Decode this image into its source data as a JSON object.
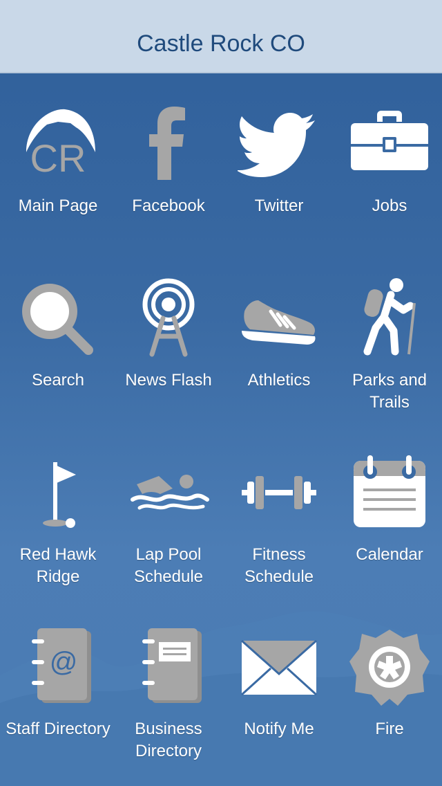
{
  "header": {
    "title": "Castle Rock CO"
  },
  "tiles": [
    {
      "label": "Main Page",
      "icon": "castle-rock-logo-icon"
    },
    {
      "label": "Facebook",
      "icon": "facebook-icon"
    },
    {
      "label": "Twitter",
      "icon": "twitter-bird-icon"
    },
    {
      "label": "Jobs",
      "icon": "briefcase-icon"
    },
    {
      "label": "Search",
      "icon": "magnifier-icon"
    },
    {
      "label": "News Flash",
      "icon": "broadcast-tower-icon"
    },
    {
      "label": "Athletics",
      "icon": "sneaker-icon"
    },
    {
      "label": "Parks and Trails",
      "icon": "hiker-icon"
    },
    {
      "label": "Red Hawk Ridge",
      "icon": "golf-flag-icon"
    },
    {
      "label": "Lap Pool Schedule",
      "icon": "swimmer-icon"
    },
    {
      "label": "Fitness Schedule",
      "icon": "dumbbell-icon"
    },
    {
      "label": "Calendar",
      "icon": "calendar-icon"
    },
    {
      "label": "Staff Directory",
      "icon": "address-book-icon"
    },
    {
      "label": "Business Directory",
      "icon": "notebook-icon"
    },
    {
      "label": "Notify Me",
      "icon": "envelope-icon"
    },
    {
      "label": "Fire",
      "icon": "fire-department-icon"
    }
  ],
  "colors": {
    "header_bg": "#c9d8e8",
    "header_text": "#1f4a7c",
    "icon_gray": "#a6a6a6",
    "icon_white": "#ffffff",
    "background": "#3a6aa3"
  }
}
